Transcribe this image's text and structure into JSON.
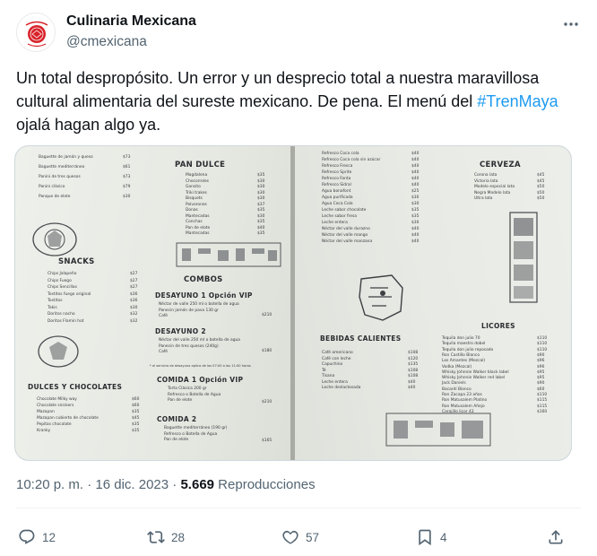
{
  "author": {
    "name": "Culinaria Mexicana",
    "handle": "@cmexicana"
  },
  "tweet": {
    "text_before": "Un total despropósito. Un error y un desprecio total a nuestra maravillosa cultural alimentaria del sureste mexicano. De pena. El menú del ",
    "hashtag": "#TrenMaya",
    "text_after": " ojalá hagan algo ya."
  },
  "meta": {
    "time": "10:20 p. m.",
    "sep1": " · ",
    "date": "16 dic. 2023",
    "sep2": " · ",
    "views": "5.669",
    "views_label": " Reproducciones"
  },
  "actions": {
    "replies": "12",
    "retweets": "28",
    "likes": "57",
    "bookmarks": "4"
  },
  "menu": {
    "left": {
      "pan_dulce": "PAN DULCE",
      "snacks": "SNACKS",
      "combos": "COMBOS",
      "desayuno1": "DESAYUNO 1 Opción VIP",
      "desayuno1_items": [
        "Néctar de valle 250 ml o botella de agua",
        "Panecin jamón de pavo 130 gr",
        "Café"
      ],
      "desayuno1_price": "$210",
      "desayuno2": "DESAYUNO 2",
      "desayuno2_items": [
        "Néctar del valle 250 ml o botella de agua",
        "Panecin de tres quesos (240g)",
        "Café"
      ],
      "desayuno2_price": "$180",
      "desayuno_note": "* el servicio de desayuno aplica de las 07:00 a las 11:00 horas",
      "comida1": "COMIDA 1 Opción VIP",
      "comida1_items": [
        "Torta Clásica 200 gr",
        "Refresco o Botella de Agua",
        "Pan de elote"
      ],
      "comida1_price": "$210",
      "comida2": "COMIDA 2",
      "comida2_items": [
        "Baguette mediterráneo (190 gr)",
        "Refresco o Botella de Agua",
        "Pan de elote"
      ],
      "comida2_price": "$165",
      "dulces": "DULCES Y CHOCOLATES",
      "dulces_items": [
        "Chocolate Milky way",
        "Chocolate snickers",
        "Mazapan",
        "Mazapan cubierto de chocolate",
        "Pepitas chocolate",
        "Kranky"
      ],
      "dulces_prices": [
        "$60",
        "$60",
        "$35",
        "$45",
        "$35",
        "$35"
      ],
      "snacks_items": [
        "Chips Jalapeño",
        "Chips Fuego",
        "Chips Sencillas",
        "Tostitos fuego original",
        "Tostitos",
        "Takis",
        "Doritos nacho",
        "Doritos Flamin hot"
      ],
      "snacks_prices": [
        "$27",
        "$27",
        "$27",
        "$36",
        "$36",
        "$30",
        "$32",
        "$32"
      ],
      "pan_items": [
        "Magdalena",
        "Chocorroles",
        "Gansito",
        "Triki trakes",
        "Bisquets",
        "Polvorones",
        "Donas",
        "Mantecadas",
        "Conchas",
        "Pan de elote",
        "Mantecadas"
      ],
      "pan_prices": [
        "$35",
        "$30",
        "$30",
        "$30",
        "$30",
        "$37",
        "$35",
        "$30",
        "$35",
        "$40",
        "$35"
      ],
      "top_items": [
        "Baguette de jamón y queso",
        "Baguette mediterráneo",
        "Panini de tres quesos",
        "Panini clásico",
        "Panque de elote"
      ],
      "top_prices": [
        "$73",
        "$61",
        "$73",
        "$79",
        "$30"
      ]
    },
    "right": {
      "refrescos_items": [
        "Refresco Coca cola",
        "Refresco Coca cola sin azúcar",
        "Refresco Fresca",
        "Refresco Sprite",
        "Refresco Fanta",
        "Refresco Sidral",
        "Agua bonafont",
        "Agua purificada",
        "Agua Coca Cola",
        "Leche sabor chocolate",
        "Leche sabor fresa",
        "Leche entera",
        "Néctar del valle durazno",
        "Néctar del valle mango",
        "Néctar del valle manzana"
      ],
      "refrescos_prices": [
        "$40",
        "$40",
        "$40",
        "$40",
        "$40",
        "$40",
        "$25",
        "$30",
        "$30",
        "$35",
        "$35",
        "$30",
        "$40",
        "$40",
        "$40"
      ],
      "cerveza": "CERVEZA",
      "cerveza_items": [
        "Corona lata",
        "Victoria lata",
        "Modelo especial lata",
        "Negra Modelo lata",
        "Ultra lata"
      ],
      "cerveza_prices": [
        "$45",
        "$45",
        "$50",
        "$50",
        "$50"
      ],
      "bebidas": "BEBIDAS CALIENTES",
      "bebidas_items": [
        "Café americano",
        "Café con leche",
        "Capuchino",
        "Té",
        "Tisana",
        "Leche entera",
        "Leche deslactosada"
      ],
      "bebidas_prices": [
        "$108",
        "$120",
        "$135",
        "$108",
        "$108",
        "$40",
        "$40"
      ],
      "licores": "LICORES",
      "licores_items": [
        "Tequila don julio 70",
        "Tequila maestro dobel",
        "Tequila don julio reposado",
        "Ron Castillo Blanco",
        "Los Amantes (Mezcal)",
        "Vodka (Mezcal)",
        "Whisky Johnnie Walker black label",
        "Whisky Johnnie Walker red label",
        "Jack Daniels",
        "Bacardí Blanco",
        "Ron Zacapa 23 años",
        "Ron Matusalem Platino",
        "Ron Matusalem Añejo",
        "Carajillo licor 43"
      ],
      "licores_prices": [
        "$110",
        "$110",
        "$110",
        "$90",
        "$96",
        "$96",
        "$95",
        "$95",
        "$90",
        "$60",
        "$110",
        "$115",
        "$115",
        "$160"
      ]
    }
  },
  "colors": {
    "link": "#1d9bf0",
    "secondary": "#536471",
    "avatar_red": "#d8232a"
  },
  "icons": [
    "more-icon",
    "reply-icon",
    "retweet-icon",
    "like-icon",
    "bookmark-icon",
    "share-icon"
  ]
}
